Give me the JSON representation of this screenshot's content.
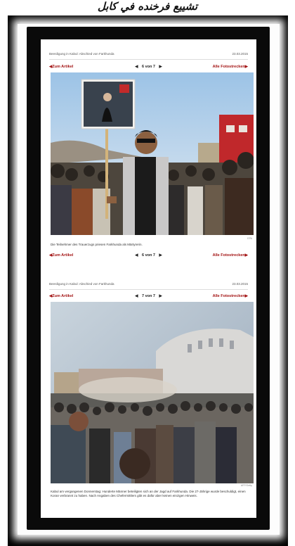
{
  "page": {
    "top_text": "ﺗﺸﻴﻴﻊ ﻓﺮﺧﻨﺪﻩ ﻓﻲ ﻛﺎﺑﻞ"
  },
  "slides": [
    {
      "meta_title": "Beerdigung in Kabul: Abschied von Farkhunda",
      "meta_date": "23.03.2015",
      "back_label": "Zum Artikel",
      "counter": "6 von 7",
      "all_label": "Alle Fotostrecken",
      "credit": "EPA",
      "caption": "Die Teilnehmer des Trauerzugs priesen Farkhunda als Märtyrerin.",
      "bottom_counter": "6 von 7"
    },
    {
      "meta_title": "Beerdigung in Kabul: Abschied von Farkhunda",
      "meta_date": "23.03.2015",
      "back_label": "Zum Artikel",
      "counter": "7 von 7",
      "all_label": "Alle Fotostrecken",
      "credit": "AFP/Getty",
      "caption": "Kabul am vergangenen Donnerstag: Hunderte Männer beteiligten sich an der Jagd auf Farkhunda. Die 27-Jährige wurde beschuldigt, einen Koran verbrannt zu haben. Nach Angaben des Chefermittlers gibt es dafür aber keinen einzigen Hinweis."
    }
  ],
  "glyphs": {
    "left": "◀",
    "right": "▶",
    "prev": "◀",
    "next": "▶"
  },
  "colors": {
    "link_red": "#a31414",
    "frame": "#000000"
  }
}
